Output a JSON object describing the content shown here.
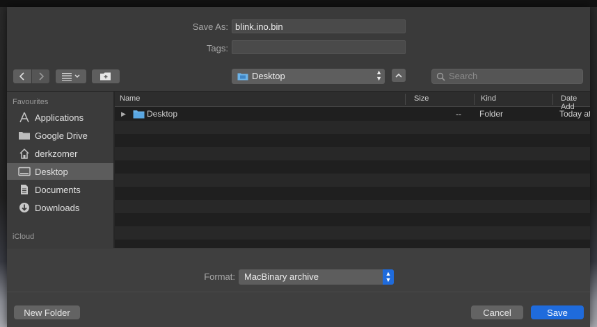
{
  "save_as": {
    "label": "Save As:",
    "value": "blink.ino.bin"
  },
  "tags": {
    "label": "Tags:",
    "value": ""
  },
  "toolbar": {
    "back_icon": "chevron-left-icon",
    "forward_icon": "chevron-right-icon",
    "view_icon": "list-view-icon",
    "new_folder_icon": "new-folder-icon",
    "location": "Desktop",
    "search_placeholder": "Search"
  },
  "sidebar": {
    "favourites_header": "Favourites",
    "items": [
      {
        "label": "Applications",
        "icon": "applications-icon"
      },
      {
        "label": "Google Drive",
        "icon": "folder-icon"
      },
      {
        "label": "derkzomer",
        "icon": "home-icon"
      },
      {
        "label": "Desktop",
        "icon": "desktop-icon",
        "selected": true
      },
      {
        "label": "Documents",
        "icon": "documents-icon"
      },
      {
        "label": "Downloads",
        "icon": "downloads-icon"
      }
    ],
    "icloud_header": "iCloud"
  },
  "list": {
    "columns": {
      "name": "Name",
      "size": "Size",
      "kind": "Kind",
      "date": "Date Add"
    },
    "rows": [
      {
        "name": "Desktop",
        "size": "--",
        "kind": "Folder",
        "date": "Today at"
      }
    ]
  },
  "format": {
    "label": "Format:",
    "value": "MacBinary archive"
  },
  "buttons": {
    "new_folder": "New Folder",
    "cancel": "Cancel",
    "save": "Save"
  },
  "colors": {
    "accent": "#1f6bdc",
    "sheet": "#3a3a3a",
    "selected": "#5c5c5c"
  }
}
